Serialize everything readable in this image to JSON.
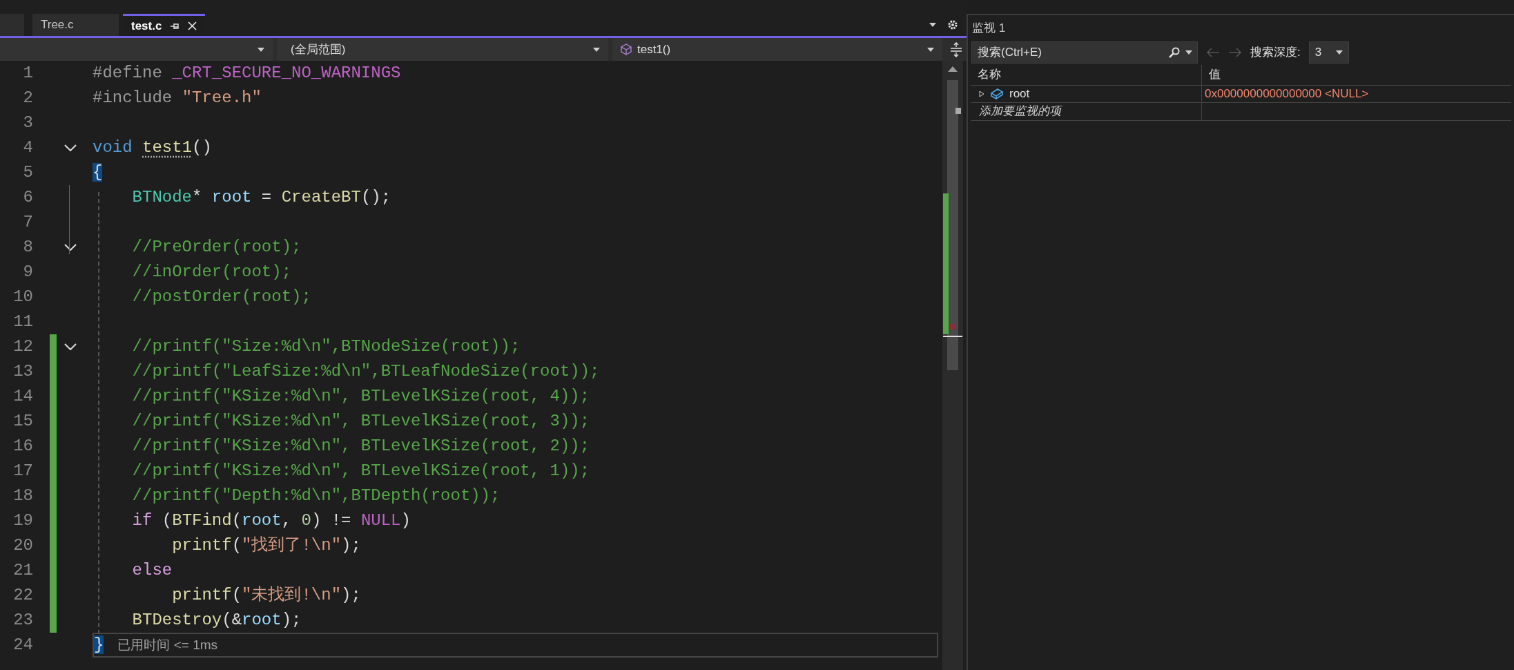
{
  "editor": {
    "tabs": [
      {
        "label": "Tree.c",
        "selected": false
      },
      {
        "label": "test.c",
        "selected": true
      }
    ],
    "nav": [
      {
        "kind": "file"
      },
      {
        "value": "(全局范围)",
        "kind": "scope"
      },
      {
        "value": "test1()",
        "kind": "function"
      }
    ],
    "lines": [
      {
        "number": "1",
        "fold": false,
        "changed": false,
        "tokens": [
          {
            "text": "#define ",
            "kind": "preprocessor"
          },
          {
            "text": "_CRT_SECURE_NO_WARNINGS",
            "kind": "macro"
          }
        ]
      },
      {
        "number": "2",
        "fold": false,
        "changed": false,
        "tokens": [
          {
            "text": "#include ",
            "kind": "preprocessor"
          },
          {
            "text": "\"Tree.h\"",
            "kind": "string"
          }
        ]
      },
      {
        "number": "3",
        "fold": false,
        "changed": false
      },
      {
        "number": "4",
        "fold": true,
        "changed": false,
        "tokens": [
          {
            "text": "void ",
            "kind": "keyword"
          },
          {
            "text": "test1",
            "kind": "function_hinted"
          },
          {
            "text": "()",
            "kind": "plain"
          }
        ]
      },
      {
        "number": "5",
        "fold": false,
        "changed": false,
        "tokens": [
          {
            "text": "{",
            "kind": "brace_match"
          }
        ]
      },
      {
        "number": "6",
        "fold": false,
        "changed": false,
        "tokens": [
          {
            "text": "    BTNode",
            "kind": "type"
          },
          {
            "text": "* ",
            "kind": "plain"
          },
          {
            "text": "root",
            "kind": "variable"
          },
          {
            "text": " = ",
            "kind": "plain"
          },
          {
            "text": "CreateBT",
            "kind": "function"
          },
          {
            "text": "();",
            "kind": "plain"
          }
        ]
      },
      {
        "number": "7",
        "fold": false,
        "changed": false
      },
      {
        "number": "8",
        "fold": true,
        "changed": false,
        "tokens": [
          {
            "text": "    //PreOrder(root);",
            "kind": "comment"
          }
        ]
      },
      {
        "number": "9",
        "fold": false,
        "changed": false,
        "tokens": [
          {
            "text": "    //inOrder(root);",
            "kind": "comment"
          }
        ]
      },
      {
        "number": "10",
        "fold": false,
        "changed": false,
        "tokens": [
          {
            "text": "    //postOrder(root);",
            "kind": "comment"
          }
        ]
      },
      {
        "number": "11",
        "fold": false,
        "changed": false
      },
      {
        "number": "12",
        "fold": true,
        "changed": true,
        "tokens": [
          {
            "text": "    //printf(\"Size:%d\\n\",BTNodeSize(root));",
            "kind": "comment"
          }
        ]
      },
      {
        "number": "13",
        "fold": false,
        "changed": true,
        "tokens": [
          {
            "text": "    //printf(\"LeafSize:%d\\n\",BTLeafNodeSize(root));",
            "kind": "comment"
          }
        ]
      },
      {
        "number": "14",
        "fold": false,
        "changed": true,
        "tokens": [
          {
            "text": "    //printf(\"KSize:%d\\n\", BTLevelKSize(root, 4));",
            "kind": "comment"
          }
        ]
      },
      {
        "number": "15",
        "fold": false,
        "changed": true,
        "tokens": [
          {
            "text": "    //printf(\"KSize:%d\\n\", BTLevelKSize(root, 3));",
            "kind": "comment"
          }
        ]
      },
      {
        "number": "16",
        "fold": false,
        "changed": true,
        "tokens": [
          {
            "text": "    //printf(\"KSize:%d\\n\", BTLevelKSize(root, 2));",
            "kind": "comment"
          }
        ]
      },
      {
        "number": "17",
        "fold": false,
        "changed": true,
        "tokens": [
          {
            "text": "    //printf(\"KSize:%d\\n\", BTLevelKSize(root, 1));",
            "kind": "comment"
          }
        ]
      },
      {
        "number": "18",
        "fold": false,
        "changed": true,
        "tokens": [
          {
            "text": "    //printf(\"Depth:%d\\n\",BTDepth(root));",
            "kind": "comment"
          }
        ]
      },
      {
        "number": "19",
        "fold": false,
        "changed": true,
        "tokens": [
          {
            "text": "    if",
            "kind": "control"
          },
          {
            "text": " (",
            "kind": "plain"
          },
          {
            "text": "BTFind",
            "kind": "function"
          },
          {
            "text": "(",
            "kind": "plain"
          },
          {
            "text": "root",
            "kind": "variable"
          },
          {
            "text": ", ",
            "kind": "plain"
          },
          {
            "text": "0",
            "kind": "number"
          },
          {
            "text": ") != ",
            "kind": "plain"
          },
          {
            "text": "NULL",
            "kind": "macro"
          },
          {
            "text": ")",
            "kind": "plain"
          }
        ]
      },
      {
        "number": "20",
        "fold": false,
        "changed": true,
        "tokens": [
          {
            "text": "        printf",
            "kind": "function"
          },
          {
            "text": "(",
            "kind": "plain"
          },
          {
            "text": "\"找到了!\\n\"",
            "kind": "string"
          },
          {
            "text": ");",
            "kind": "plain"
          }
        ]
      },
      {
        "number": "21",
        "fold": false,
        "changed": true,
        "tokens": [
          {
            "text": "    else",
            "kind": "control"
          }
        ]
      },
      {
        "number": "22",
        "fold": false,
        "changed": true,
        "tokens": [
          {
            "text": "        printf",
            "kind": "function"
          },
          {
            "text": "(",
            "kind": "plain"
          },
          {
            "text": "\"未找到!\\n\"",
            "kind": "string"
          },
          {
            "text": ");",
            "kind": "plain"
          }
        ]
      },
      {
        "number": "23",
        "fold": false,
        "changed": true,
        "tokens": [
          {
            "text": "    BTDestroy",
            "kind": "function"
          },
          {
            "text": "(&",
            "kind": "plain"
          },
          {
            "text": "root",
            "kind": "variable"
          },
          {
            "text": ");",
            "kind": "plain"
          }
        ]
      },
      {
        "number": "24",
        "fold": false,
        "changed": false,
        "current": true,
        "tokens": [
          {
            "text": "}",
            "kind": "brace_match"
          }
        ],
        "hint": "已用时间 <= 1ms"
      }
    ]
  },
  "watch": {
    "title": "监视 1",
    "search": {
      "placeholder": "搜索(Ctrl+E)"
    },
    "depth_label": "搜索深度:",
    "depth": "3",
    "columns": [
      "名称",
      "值"
    ],
    "rows": [
      {
        "name": "root",
        "value": "0x0000000000000000 <NULL>",
        "changed": true,
        "expanded": false
      }
    ],
    "add_row": "添加要监视的项"
  }
}
